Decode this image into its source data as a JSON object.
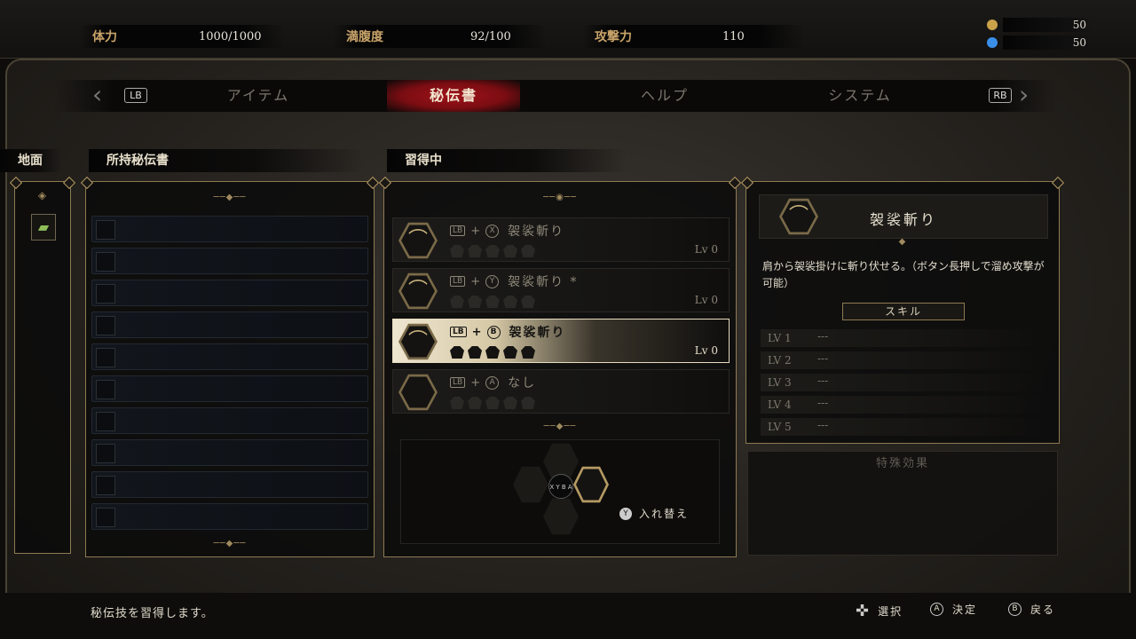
{
  "stats": {
    "hp_label": "体力",
    "hp_value": "1000/1000",
    "fullness_label": "満腹度",
    "fullness_value": "92/100",
    "attack_label": "攻撃力",
    "attack_value": "110"
  },
  "currency": {
    "gold_value": "50",
    "gold_color": "#c9a24a",
    "spirit_value": "50",
    "spirit_color": "#3a8fe8"
  },
  "tabs": {
    "left_button": "LB",
    "right_button": "RB",
    "items": [
      {
        "label": "アイテム"
      },
      {
        "label": "秘伝書",
        "active": true
      },
      {
        "label": "ヘルプ"
      },
      {
        "label": "システム"
      }
    ]
  },
  "sections": {
    "ground": "地面",
    "owned": "所持秘伝書",
    "learning": "習得中"
  },
  "owned_slots": [
    "",
    "",
    "",
    "",
    "",
    "",
    "",
    "",
    "",
    ""
  ],
  "learning": {
    "rows": [
      {
        "shoulder": "LB",
        "plus": "+",
        "face": "X",
        "name": "袈裟斬り",
        "level": "Lv 0"
      },
      {
        "shoulder": "LB",
        "plus": "+",
        "face": "Y",
        "name": "袈裟斬り *",
        "level": "Lv 0"
      },
      {
        "shoulder": "LB",
        "plus": "+",
        "face": "B",
        "name": "袈裟斬り",
        "level": "Lv 0",
        "selected": true
      },
      {
        "shoulder": "LB",
        "plus": "+",
        "face": "A",
        "name": "なし",
        "level": ""
      }
    ],
    "swap_button": "Y",
    "swap_label": "入れ替え",
    "swap_center": "X Y B A"
  },
  "detail": {
    "name": "袈裟斬り",
    "description": "肩から袈裟掛けに斬り伏せる。（ボタン長押しで溜め攻撃が可能）",
    "skill_header": "スキル",
    "levels": [
      {
        "label": "LV 1",
        "value": "---"
      },
      {
        "label": "LV 2",
        "value": "---"
      },
      {
        "label": "LV 3",
        "value": "---"
      },
      {
        "label": "LV 4",
        "value": "---"
      },
      {
        "label": "LV 5",
        "value": "---"
      }
    ],
    "effect_header": "特殊効果"
  },
  "footer": {
    "message": "秘伝技を習得します。",
    "select_label": "選択",
    "confirm_button": "A",
    "confirm_label": "決定",
    "back_button": "B",
    "back_label": "戻る"
  }
}
